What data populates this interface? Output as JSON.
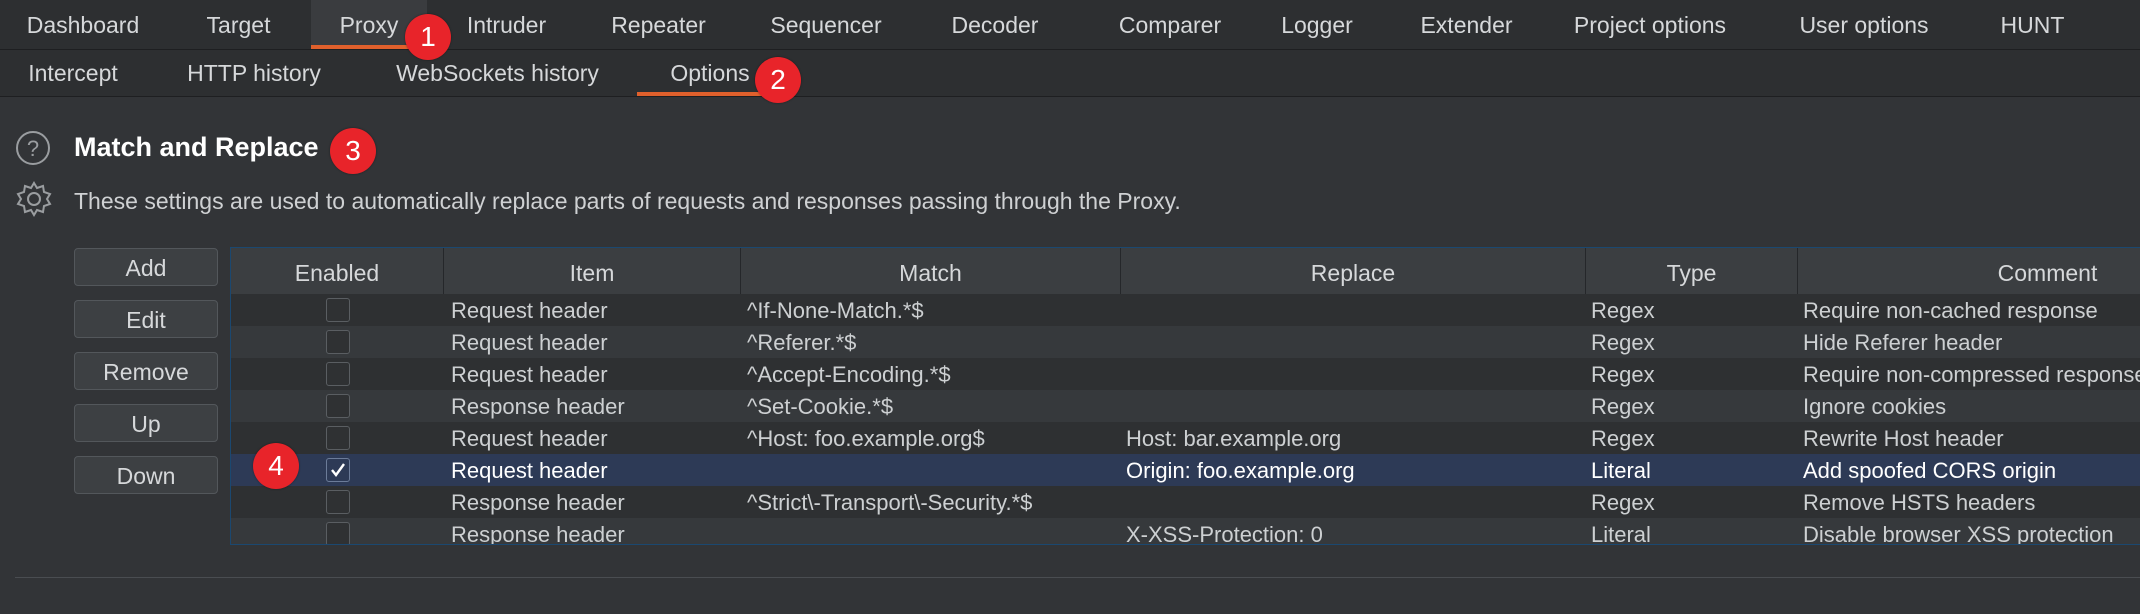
{
  "tabs": [
    {
      "label": "Dashboard"
    },
    {
      "label": "Target"
    },
    {
      "label": "Proxy"
    },
    {
      "label": "Intruder"
    },
    {
      "label": "Repeater"
    },
    {
      "label": "Sequencer"
    },
    {
      "label": "Decoder"
    },
    {
      "label": "Comparer"
    },
    {
      "label": "Logger"
    },
    {
      "label": "Extender"
    },
    {
      "label": "Project options"
    },
    {
      "label": "User options"
    },
    {
      "label": "HUNT"
    }
  ],
  "active_tab": "Proxy",
  "subtabs": [
    {
      "label": "Intercept"
    },
    {
      "label": "HTTP history"
    },
    {
      "label": "WebSockets history"
    },
    {
      "label": "Options"
    }
  ],
  "active_subtab": "Options",
  "section": {
    "title": "Match and Replace",
    "description": "These settings are used to automatically replace parts of requests and responses passing through the Proxy."
  },
  "buttons": {
    "add": "Add",
    "edit": "Edit",
    "remove": "Remove",
    "up": "Up",
    "down": "Down"
  },
  "table": {
    "columns": [
      "Enabled",
      "Item",
      "Match",
      "Replace",
      "Type",
      "Comment"
    ],
    "rows": [
      {
        "enabled": false,
        "item": "Request header",
        "match": "^If-None-Match.*$",
        "replace": "",
        "type": "Regex",
        "comment": "Require non-cached response"
      },
      {
        "enabled": false,
        "item": "Request header",
        "match": "^Referer.*$",
        "replace": "",
        "type": "Regex",
        "comment": "Hide Referer header"
      },
      {
        "enabled": false,
        "item": "Request header",
        "match": "^Accept-Encoding.*$",
        "replace": "",
        "type": "Regex",
        "comment": "Require non-compressed responses"
      },
      {
        "enabled": false,
        "item": "Response header",
        "match": "^Set-Cookie.*$",
        "replace": "",
        "type": "Regex",
        "comment": "Ignore cookies"
      },
      {
        "enabled": false,
        "item": "Request header",
        "match": "^Host: foo.example.org$",
        "replace": "Host: bar.example.org",
        "type": "Regex",
        "comment": "Rewrite Host header"
      },
      {
        "enabled": true,
        "item": "Request header",
        "match": "",
        "replace": "Origin: foo.example.org",
        "type": "Literal",
        "comment": "Add spoofed CORS origin",
        "selected": true
      },
      {
        "enabled": false,
        "item": "Response header",
        "match": "^Strict\\-Transport\\-Security.*$",
        "replace": "",
        "type": "Regex",
        "comment": "Remove HSTS headers"
      },
      {
        "enabled": false,
        "item": "Response header",
        "match": "",
        "replace": "X-XSS-Protection: 0",
        "type": "Literal",
        "comment": "Disable browser XSS protection"
      }
    ]
  },
  "annotations": [
    "1",
    "2",
    "3",
    "4"
  ],
  "colors": {
    "accent": "#e0602c",
    "badge": "#e8242a",
    "selected_row": "#2d3a56",
    "background": "#323437"
  },
  "icons": {
    "help": "help-icon",
    "settings": "gear-icon",
    "check": "checkmark-icon"
  }
}
